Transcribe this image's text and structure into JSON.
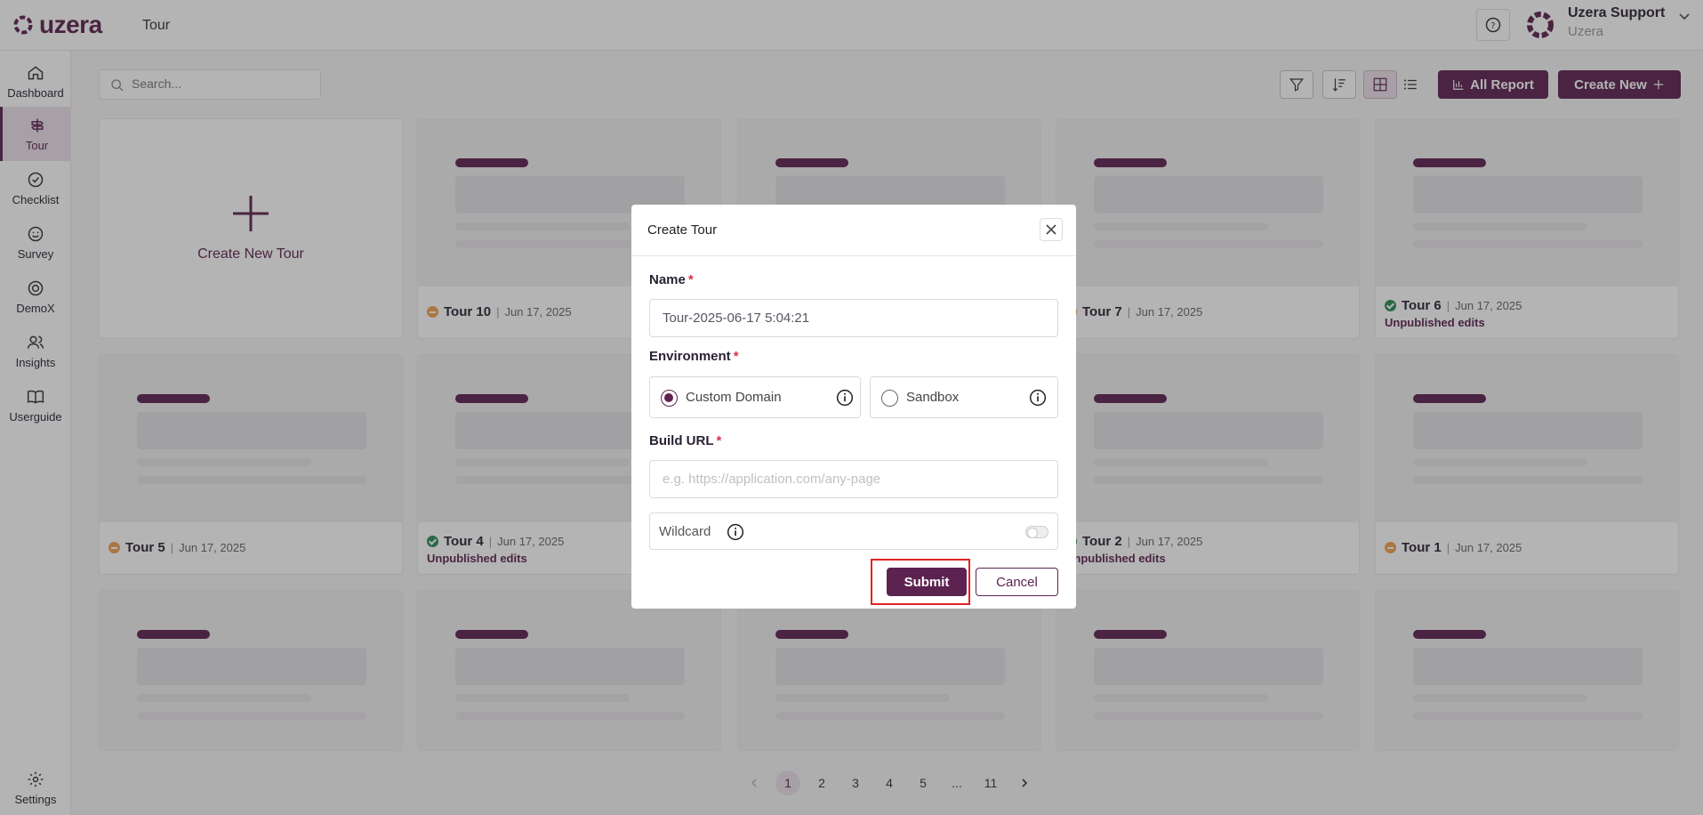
{
  "header": {
    "logo_text": "uzera",
    "page_name": "Tour",
    "user_name": "Uzera Support",
    "user_org": "Uzera"
  },
  "sidebar": {
    "items": [
      {
        "label": "Dashboard",
        "icon": "home-icon"
      },
      {
        "label": "Tour",
        "icon": "tour-icon",
        "active": true
      },
      {
        "label": "Checklist",
        "icon": "check-circle-icon"
      },
      {
        "label": "Survey",
        "icon": "smile-icon"
      },
      {
        "label": "DemoX",
        "icon": "target-icon"
      },
      {
        "label": "Insights",
        "icon": "users-icon"
      },
      {
        "label": "Userguide",
        "icon": "book-icon"
      }
    ],
    "settings_label": "Settings"
  },
  "toolbar": {
    "search_placeholder": "Search...",
    "all_report_label": "All Report",
    "create_new_label": "Create New"
  },
  "create_card": {
    "label": "Create New Tour"
  },
  "tours": [
    {
      "title": "Tour 10",
      "date": "Jun 17, 2025",
      "status": "draft",
      "note": ""
    },
    {
      "title": "",
      "date": "",
      "status": "",
      "note": ""
    },
    {
      "title": "Tour 7",
      "date": "Jun 17, 2025",
      "status": "draft",
      "note": ""
    },
    {
      "title": "Tour 6",
      "date": "Jun 17, 2025",
      "status": "published",
      "note": "Unpublished edits"
    },
    {
      "title": "Tour 5",
      "date": "Jun 17, 2025",
      "status": "draft",
      "note": ""
    },
    {
      "title": "Tour 4",
      "date": "Jun 17, 2025",
      "status": "published",
      "note": "Unpublished edits"
    },
    {
      "title": "",
      "date": "",
      "status": "",
      "note": ""
    },
    {
      "title": "Tour 2",
      "date": "Jun 17, 2025",
      "status": "published",
      "note": "Unpublished edits"
    },
    {
      "title": "Tour 1",
      "date": "Jun 17, 2025",
      "status": "draft",
      "note": ""
    }
  ],
  "pagination": {
    "pages": [
      "1",
      "2",
      "3",
      "4",
      "5",
      "...",
      "11"
    ],
    "current": "1"
  },
  "modal": {
    "title": "Create Tour",
    "name_label": "Name",
    "name_value": "Tour-2025-06-17 5:04:21",
    "environment_label": "Environment",
    "env_options": [
      "Custom Domain",
      "Sandbox"
    ],
    "env_selected": "Custom Domain",
    "build_url_label": "Build URL",
    "build_url_placeholder": "e.g. https://application.com/any-page",
    "wildcard_label": "Wildcard",
    "wildcard_on": false,
    "submit_label": "Submit",
    "cancel_label": "Cancel"
  },
  "colors": {
    "brand": "#5c2350",
    "required": "#d9304a",
    "draft": "#f0a050",
    "published": "#2f8a58"
  }
}
